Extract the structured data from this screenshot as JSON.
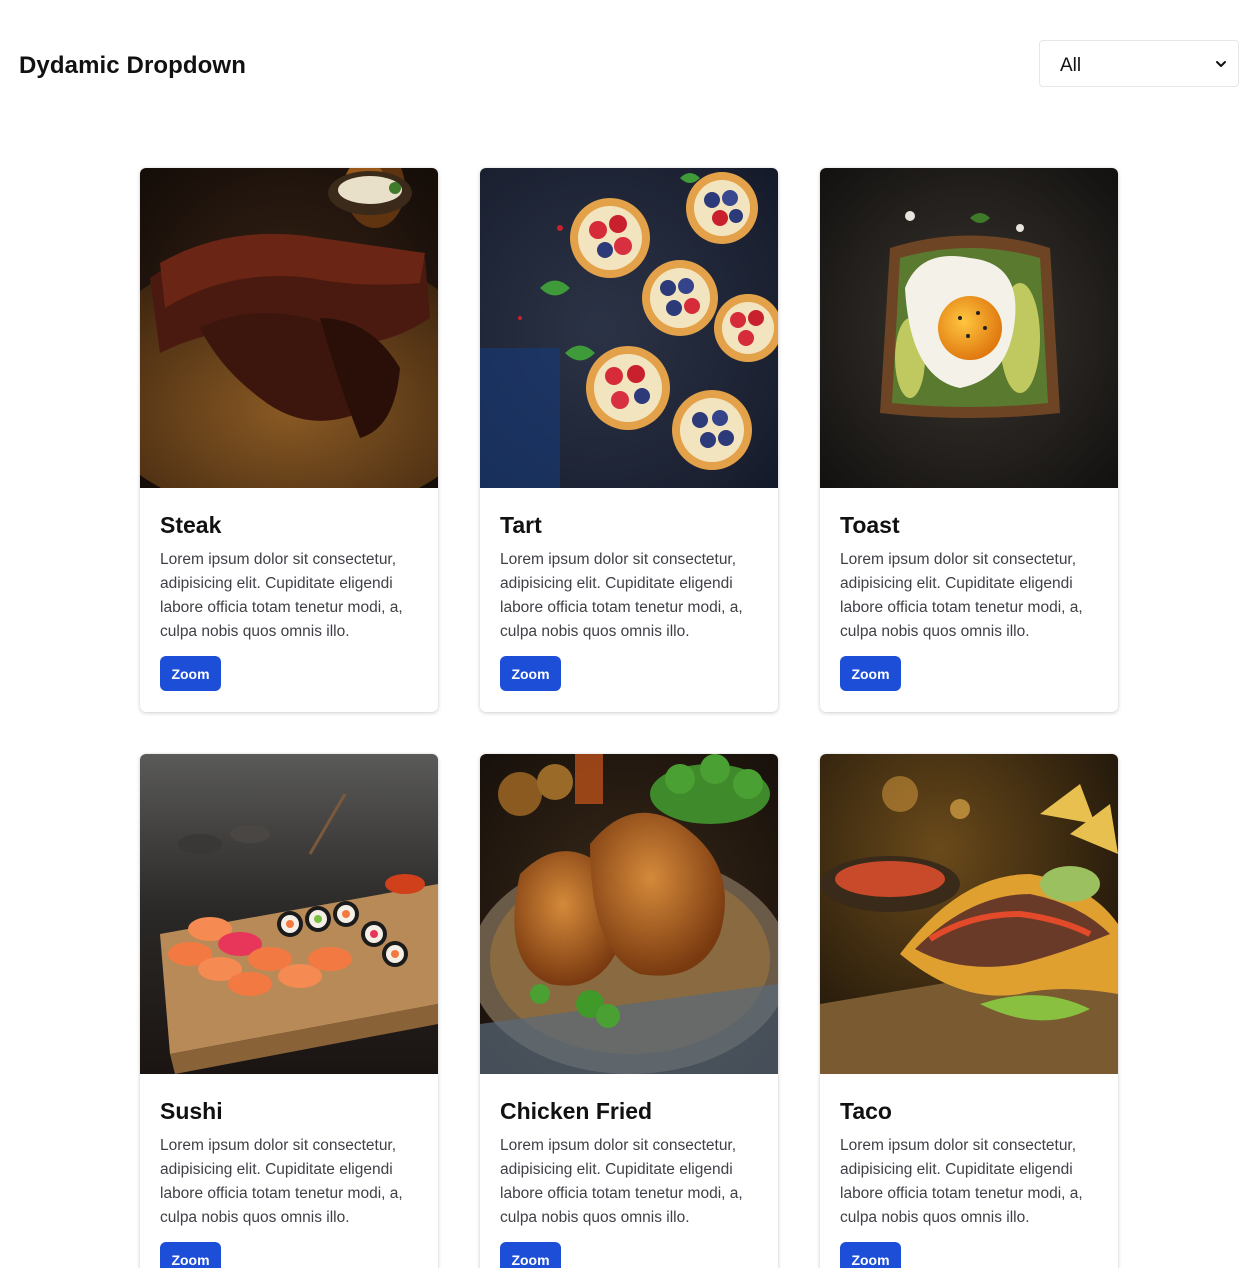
{
  "header": {
    "title": "Dydamic Dropdown",
    "filter": {
      "selected": "All",
      "icon": "chevron-down-icon"
    }
  },
  "cards": [
    {
      "title": "Steak",
      "description": "Lorem ipsum dolor sit consectetur, adipisicing elit. Cupiditate eligendi labore officia totam tenetur modi, a, culpa nobis quos omnis illo.",
      "button": "Zoom",
      "image": "steak-photo"
    },
    {
      "title": "Tart",
      "description": "Lorem ipsum dolor sit consectetur, adipisicing elit. Cupiditate eligendi labore officia totam tenetur modi, a, culpa nobis quos omnis illo.",
      "button": "Zoom",
      "image": "tart-photo"
    },
    {
      "title": "Toast",
      "description": "Lorem ipsum dolor sit consectetur, adipisicing elit. Cupiditate eligendi labore officia totam tenetur modi, a, culpa nobis quos omnis illo.",
      "button": "Zoom",
      "image": "toast-photo"
    },
    {
      "title": "Sushi",
      "description": "Lorem ipsum dolor sit consectetur, adipisicing elit. Cupiditate eligendi labore officia totam tenetur modi, a, culpa nobis quos omnis illo.",
      "button": "Zoom",
      "image": "sushi-photo"
    },
    {
      "title": "Chicken Fried",
      "description": "Lorem ipsum dolor sit consectetur, adipisicing elit. Cupiditate eligendi labore officia totam tenetur modi, a, culpa nobis quos omnis illo.",
      "button": "Zoom",
      "image": "fried-chicken-photo"
    },
    {
      "title": "Taco",
      "description": "Lorem ipsum dolor sit consectetur, adipisicing elit. Cupiditate eligendi labore officia totam tenetur modi, a, culpa nobis quos omnis illo.",
      "button": "Zoom",
      "image": "taco-photo"
    }
  ],
  "colors": {
    "button": "#1d4ed8",
    "title": "#111111",
    "body_text": "#3f3f46"
  }
}
